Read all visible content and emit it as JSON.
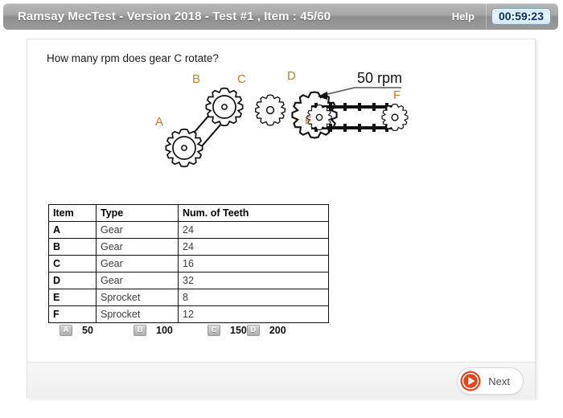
{
  "header": {
    "title": "Ramsay MecTest - Version 2018 - Test #1 , Item : 45/60",
    "help_label": "Help",
    "timer": "00:59:23",
    "timer_color": "#0d2f52",
    "bar_color": "#9a9a9a"
  },
  "question": {
    "text": "How many rpm does gear C rotate?"
  },
  "diagram": {
    "annotation": "50 rpm",
    "labels": {
      "a": "A",
      "b": "B",
      "c": "C",
      "d": "D",
      "e": "E",
      "f": "F"
    },
    "label_color": "#c87a28"
  },
  "table": {
    "headers": [
      "Item",
      "Type",
      "Num. of Teeth"
    ],
    "rows": [
      {
        "item": "A",
        "type": "Gear",
        "teeth": "24"
      },
      {
        "item": "B",
        "type": "Gear",
        "teeth": "24"
      },
      {
        "item": "C",
        "type": "Gear",
        "teeth": "16"
      },
      {
        "item": "D",
        "type": "Gear",
        "teeth": "32"
      },
      {
        "item": "E",
        "type": "Sprocket",
        "teeth": "8"
      },
      {
        "item": "F",
        "type": "Sprocket",
        "teeth": "12"
      }
    ]
  },
  "options": [
    {
      "key": "A",
      "value": "50"
    },
    {
      "key": "B",
      "value": "100"
    },
    {
      "key": "C",
      "value": "150"
    },
    {
      "key": "D",
      "value": "200"
    }
  ],
  "footer": {
    "next_label": "Next",
    "next_icon_color": "#e8441a"
  }
}
